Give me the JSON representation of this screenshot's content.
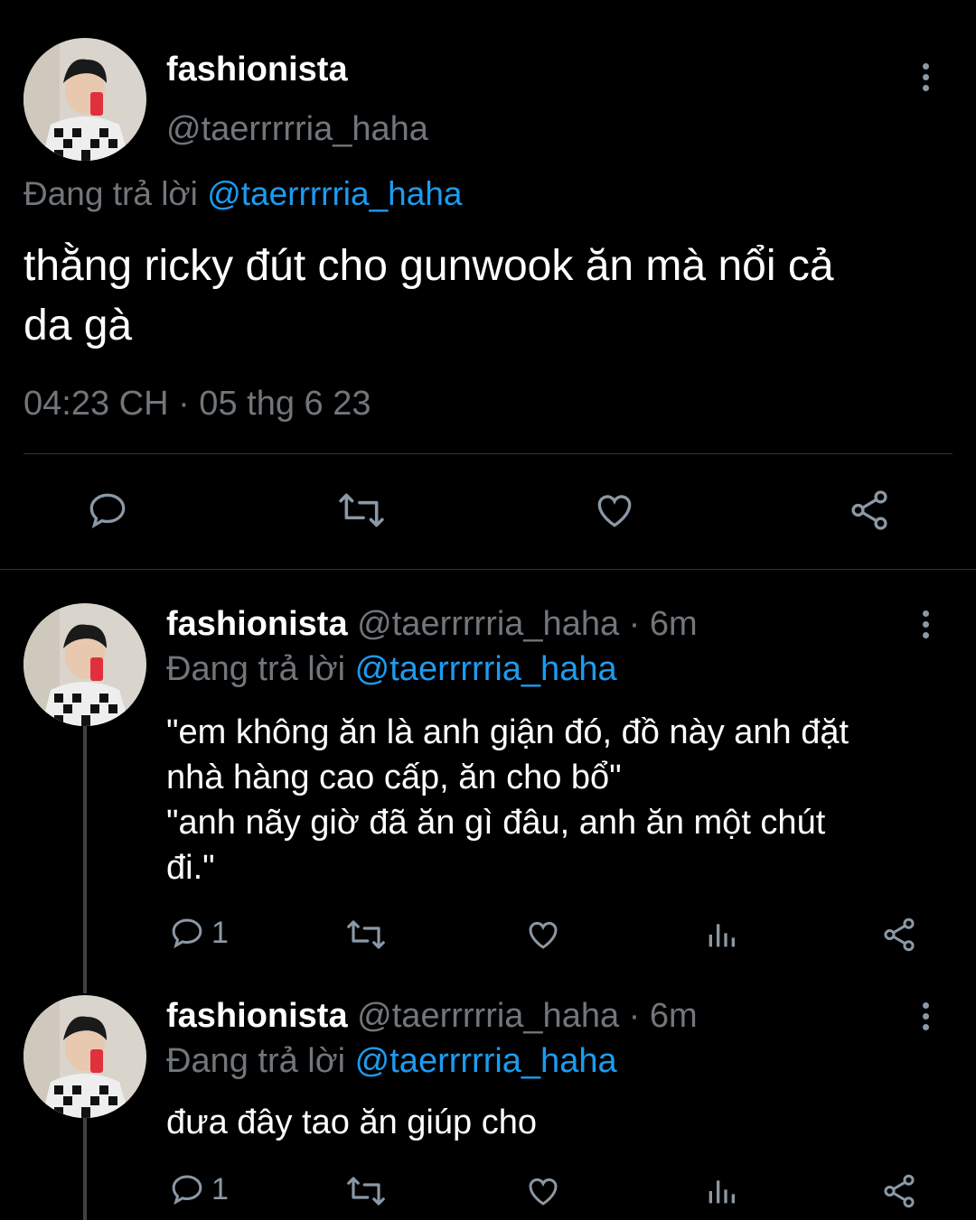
{
  "main_tweet": {
    "display_name": "fashionista",
    "handle": "@taerrrrria_haha",
    "replying_prefix": "Đang trả lời",
    "replying_to": "@taerrrrria_haha",
    "text_line1": "thằng ricky đút cho gunwook ăn mà nổi cả",
    "text_line2": "da gà",
    "timestamp": "04:23 CH · 05 thg 6 23",
    "actions": {
      "reply_icon": "reply-icon",
      "retweet_icon": "retweet-icon",
      "like_icon": "heart-icon",
      "share_icon": "share-icon"
    }
  },
  "replies": [
    {
      "display_name": "fashionista",
      "handle": "@taerrrrria_haha",
      "time": "· 6m",
      "replying_prefix": "Đang trả lời",
      "replying_to": "@taerrrrria_haha",
      "lines": [
        "\"em không ăn là anh giận đó, đồ này anh đặt",
        "nhà hàng cao cấp, ăn cho bổ\"",
        "\"anh nãy giờ đã ăn gì đâu, anh ăn một chút",
        "đi.\""
      ],
      "reply_count": "1"
    },
    {
      "display_name": "fashionista",
      "handle": "@taerrrrria_haha",
      "time": "· 6m",
      "replying_prefix": "Đang trả lời",
      "replying_to": "@taerrrrria_haha",
      "lines": [
        "đưa đây tao ăn giúp cho"
      ],
      "reply_count": "1"
    }
  ],
  "colors": {
    "background": "#000000",
    "text": "#e7e9ea",
    "muted": "#71767b",
    "link": "#1d9bf0"
  }
}
